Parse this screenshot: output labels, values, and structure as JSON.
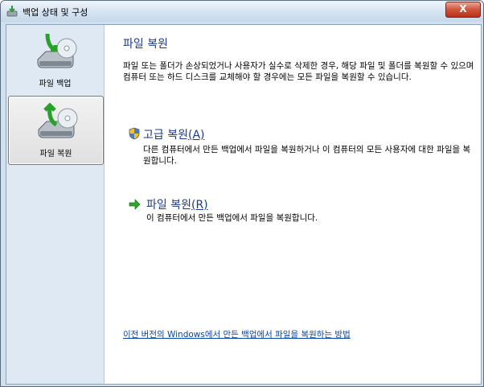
{
  "window": {
    "title": "백업 상태 및 구성",
    "close_label": "X"
  },
  "sidebar": {
    "items": [
      {
        "label": "파일 백업",
        "selected": false
      },
      {
        "label": "파일 복원",
        "selected": true
      }
    ]
  },
  "main": {
    "heading": "파일 복원",
    "intro": "파일 또는 폴더가 손상되었거나 사용자가 실수로 삭제한 경우, 해당 파일 및 폴더를 복원할 수 있으며 컴퓨터 또는 하드 디스크를 교체해야 할 경우에는 모든 파일을 복원할 수 있습니다.",
    "options": [
      {
        "title": "고급 복원",
        "accel": "(A)",
        "desc": "다른 컴퓨터에서 만든 백업에서 파일을 복원하거나 이 컴퓨터의 모든 사용자에 대한 파일을 복원합니다."
      },
      {
        "title": "파일 복원",
        "accel": "(R)",
        "desc": "이 컴퓨터에서 만든 백업에서 파일을 복원합니다."
      }
    ],
    "help_link": "이전 버전의 Windows에서 만든 백업에서 파일을 복원하는 방법"
  },
  "colors": {
    "heading": "#1e3b8a",
    "link": "#0645ad",
    "sidebar_bg": "#dfe9f4"
  },
  "icons": {
    "title": "backup-window-icon",
    "backup": "backup-drive-icon",
    "restore": "restore-drive-icon",
    "shield": "uac-shield-icon",
    "arrow": "green-arrow-icon"
  }
}
